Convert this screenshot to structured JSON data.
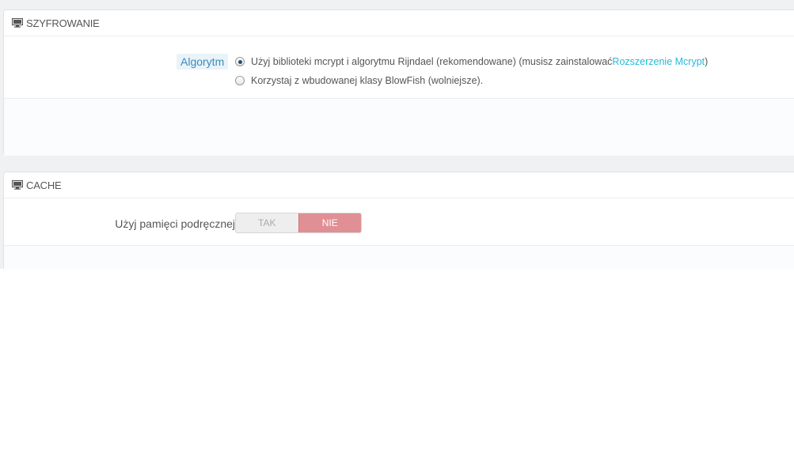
{
  "encryption": {
    "title": "SZYFROWANIE",
    "algorithm_label": "Algorytm",
    "options": [
      {
        "text": "Użyj biblioteki mcrypt i algorytmu Rijndael (rekomendowane) (musisz zainstalować ",
        "link_text": "Rozszerzenie Mcrypt",
        "suffix": ")",
        "checked": true
      },
      {
        "text": "Korzystaj z wbudowanej klasy BlowFish (wolniejsze).",
        "checked": false
      }
    ]
  },
  "cache": {
    "title": "CACHE",
    "use_cache_label": "Użyj pamięci podręcznej",
    "switch": {
      "yes_label": "TAK",
      "no_label": "NIE",
      "selected": "NIE"
    }
  },
  "colors": {
    "link": "#25b9d7",
    "label_accent": "#3e8ab8",
    "switch_no_active": "#e08f95"
  }
}
